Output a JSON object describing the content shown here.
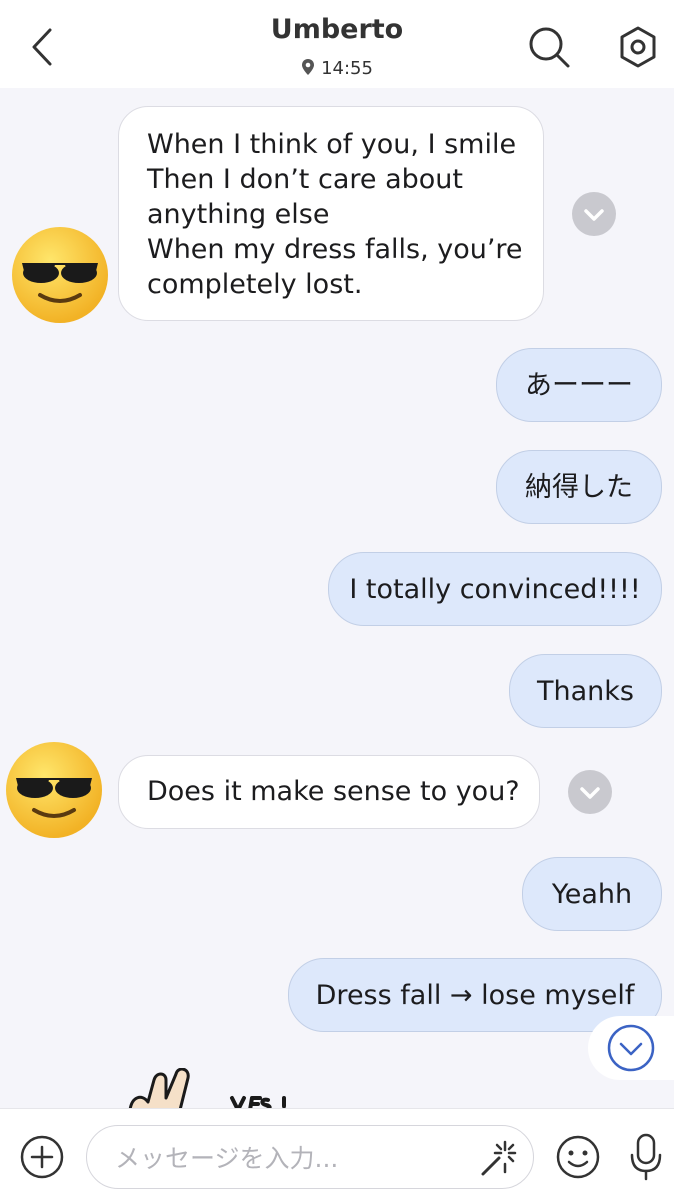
{
  "header": {
    "contact_name": "Umberto",
    "time": "14:55"
  },
  "messages": [
    {
      "side": "received",
      "lines": [
        "When I think of you, I smile",
        "Then I don’t care about",
        "anything else",
        "When my dress falls, you’re",
        "completely lost."
      ]
    },
    {
      "side": "sent",
      "text": "あーーー"
    },
    {
      "side": "sent",
      "text": "納得した"
    },
    {
      "side": "sent",
      "text": "I totally convinced!!!!"
    },
    {
      "side": "sent",
      "text": "Thanks"
    },
    {
      "side": "received",
      "text": "Does it make sense to you?"
    },
    {
      "side": "sent",
      "text": "Yeahh"
    },
    {
      "side": "sent",
      "text": "Dress fall → lose myself"
    }
  ],
  "composer": {
    "placeholder": "メッセージを入力..."
  },
  "colors": {
    "sent_bubble": "#dde8fb",
    "received_bubble": "#ffffff",
    "background": "#f5f5fa",
    "accent": "#3b63c4"
  },
  "icons": [
    "back-icon",
    "location-pin-icon",
    "search-icon",
    "settings-icon",
    "chevron-down-icon",
    "scroll-down-icon",
    "plus-icon",
    "magic-wand-icon",
    "emoji-icon",
    "microphone-icon"
  ]
}
